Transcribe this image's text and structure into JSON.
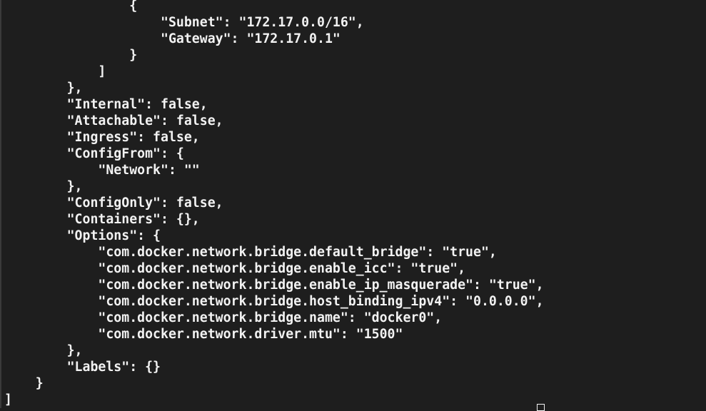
{
  "terminal": {
    "lines": [
      "                {",
      "                    \"Subnet\": \"172.17.0.0/16\",",
      "                    \"Gateway\": \"172.17.0.1\"",
      "                }",
      "            ]",
      "        },",
      "        \"Internal\": false,",
      "        \"Attachable\": false,",
      "        \"Ingress\": false,",
      "        \"ConfigFrom\": {",
      "            \"Network\": \"\"",
      "        },",
      "        \"ConfigOnly\": false,",
      "        \"Containers\": {},",
      "        \"Options\": {",
      "            \"com.docker.network.bridge.default_bridge\": \"true\",",
      "            \"com.docker.network.bridge.enable_icc\": \"true\",",
      "            \"com.docker.network.bridge.enable_ip_masquerade\": \"true\",",
      "            \"com.docker.network.bridge.host_binding_ipv4\": \"0.0.0.0\",",
      "            \"com.docker.network.bridge.name\": \"docker0\",",
      "            \"com.docker.network.driver.mtu\": \"1500\"",
      "        },",
      "        \"Labels\": {}",
      "    }",
      "]"
    ]
  },
  "colors": {
    "background": "#1e1e1e",
    "foreground": "#f2f2f2"
  }
}
